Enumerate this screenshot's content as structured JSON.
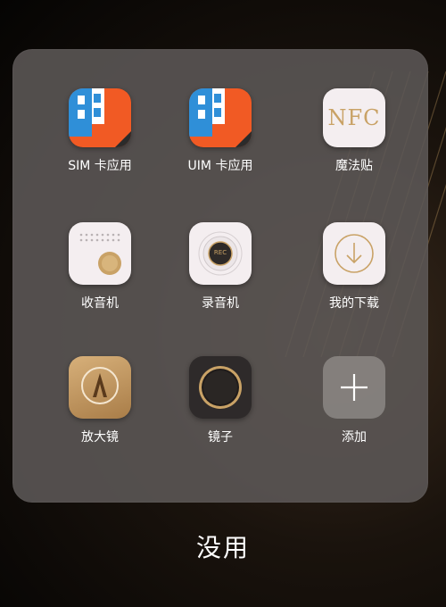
{
  "folder": {
    "title": "没用"
  },
  "apps": [
    {
      "label": "SIM 卡应用",
      "icon": "sim-card-icon"
    },
    {
      "label": "UIM 卡应用",
      "icon": "uim-card-icon"
    },
    {
      "label": "魔法贴",
      "icon": "nfc-icon",
      "icon_text": "NFC"
    },
    {
      "label": "收音机",
      "icon": "radio-icon"
    },
    {
      "label": "录音机",
      "icon": "recorder-icon",
      "icon_text": "REC"
    },
    {
      "label": "我的下载",
      "icon": "download-icon"
    },
    {
      "label": "放大镜",
      "icon": "magnifier-icon"
    },
    {
      "label": "镜子",
      "icon": "mirror-icon"
    },
    {
      "label": "添加",
      "icon": "add-icon"
    }
  ],
  "colors": {
    "sim_orange": "#f15a24",
    "sim_blue": "#2f8fd8",
    "gold": "#c9a266",
    "panel": "#5c5856"
  }
}
